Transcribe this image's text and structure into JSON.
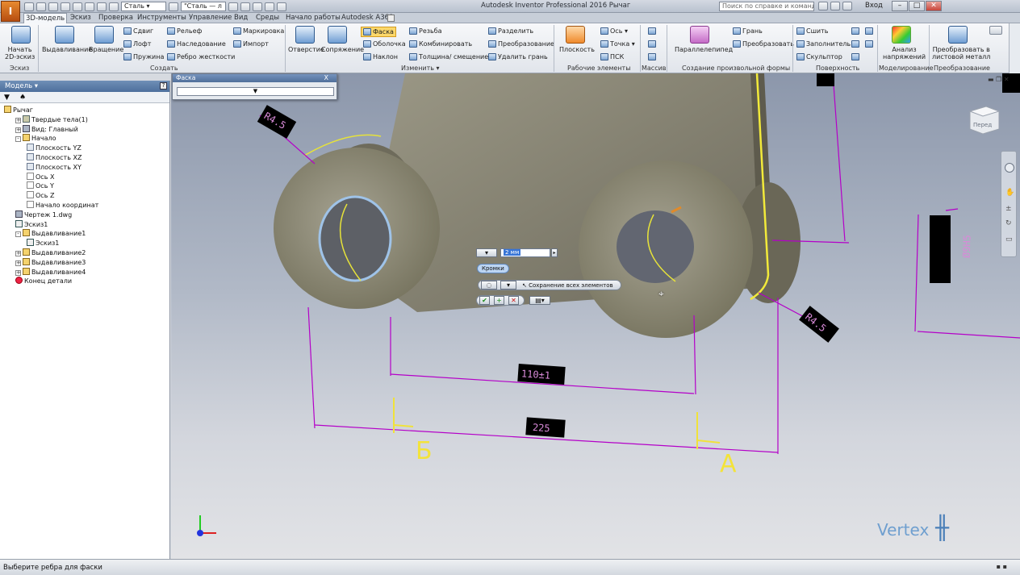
{
  "titlebar": {
    "app_badge": "I",
    "material": "Сталь",
    "appearance": "\"Сталь — л",
    "title": "Autodesk Inventor Professional 2016   Рычаг",
    "search_placeholder": "Поиск по справке и командам",
    "sign_in": "Вход"
  },
  "tabs": [
    "3D-модель",
    "Эскиз",
    "Проверка",
    "Инструменты",
    "Управление",
    "Вид",
    "Среды",
    "Начало работы",
    "Autodesk A360"
  ],
  "ribbon": {
    "start_sketch": "Начать\n2D-эскиз",
    "extrude": "Выдавливание",
    "revolve": "Вращение",
    "sweep": "Сдвиг",
    "loft": "Лофт",
    "coil": "Пружина",
    "emboss": "Рельеф",
    "derive": "Наследование",
    "rib": "Ребро жесткости",
    "mark": "Маркировка",
    "import": "Импорт",
    "hole": "Отверстие",
    "fillet": "Сопряжение",
    "chamfer": "Фаска",
    "shell": "Оболочка",
    "draft": "Наклон",
    "thread": "Резьба",
    "combine": "Комбинировать",
    "thicken": "Толщина/ смещение",
    "split": "Разделить",
    "direct": "Преобразование",
    "delete_face": "Удалить грань",
    "plane": "Плоскость",
    "axis": "Ось",
    "point": "Точка",
    "ucs": "ПСК",
    "box": "Параллелепипед",
    "face": "Грань",
    "convert": "Преобразовать",
    "stitch": "Сшить",
    "patch": "Заполнитель",
    "sculpt": "Скульптор",
    "stress": "Анализ\nнапряжений",
    "to_sheet": "Преобразовать в\nлистовой металл",
    "groups": {
      "sketch": "Эскиз",
      "create": "Создать",
      "modify": "Изменить ▾",
      "work": "Рабочие элементы",
      "pattern": "Массив",
      "freeform": "Создание произвольной формы",
      "surface": "Поверхность",
      "simulation": "Моделирование",
      "convert": "Преобразование"
    }
  },
  "browser": {
    "header": "Модель ▾",
    "items": [
      {
        "label": "Рычаг",
        "indent": 0,
        "type": "part"
      },
      {
        "label": "Твердые тела(1)",
        "indent": 1,
        "type": "solid",
        "pm": "+"
      },
      {
        "label": "Вид: Главный",
        "indent": 1,
        "type": "dwg",
        "pm": "+"
      },
      {
        "label": "Начало",
        "indent": 1,
        "type": "part",
        "pm": "-"
      },
      {
        "label": "Плоскость YZ",
        "indent": 2,
        "type": "plane"
      },
      {
        "label": "Плоскость XZ",
        "indent": 2,
        "type": "plane"
      },
      {
        "label": "Плоскость XY",
        "indent": 2,
        "type": "plane"
      },
      {
        "label": "Ось X",
        "indent": 2,
        "type": "axis"
      },
      {
        "label": "Ось Y",
        "indent": 2,
        "type": "axis"
      },
      {
        "label": "Ось Z",
        "indent": 2,
        "type": "axis"
      },
      {
        "label": "Начало координат",
        "indent": 2,
        "type": "axis"
      },
      {
        "label": "Чертеж 1.dwg",
        "indent": 1,
        "type": "dwg"
      },
      {
        "label": "Эскиз1",
        "indent": 1,
        "type": "sk"
      },
      {
        "label": "Выдавливание1",
        "indent": 1,
        "type": "part",
        "pm": "-"
      },
      {
        "label": "Эскиз1",
        "indent": 2,
        "type": "sk"
      },
      {
        "label": "Выдавливание2",
        "indent": 1,
        "type": "part",
        "pm": "+"
      },
      {
        "label": "Выдавливание3",
        "indent": 1,
        "type": "part",
        "pm": "+"
      },
      {
        "label": "Выдавливание4",
        "indent": 1,
        "type": "part",
        "pm": "+"
      },
      {
        "label": "Конец детали",
        "indent": 1,
        "type": "end"
      }
    ]
  },
  "dialog": {
    "title": "Фаска",
    "close": "X",
    "combo": "▼"
  },
  "minitoolbar": {
    "distance": "2 мм",
    "edges": "Кромки",
    "preserve": "Сохранение всех элементов",
    "ok": "✔",
    "apply": "+",
    "cancel": "✕"
  },
  "viewport": {
    "dims": {
      "r45": "R4.5",
      "d110": "110±1",
      "d225": "225",
      "r45b": "R4.5",
      "hbot": "Б",
      "hright": "А",
      "h5": "Ø9H5"
    },
    "viewcube": "Перед",
    "watermark": "Vertex"
  },
  "status": {
    "text": "Выберите ребра для фаски"
  }
}
